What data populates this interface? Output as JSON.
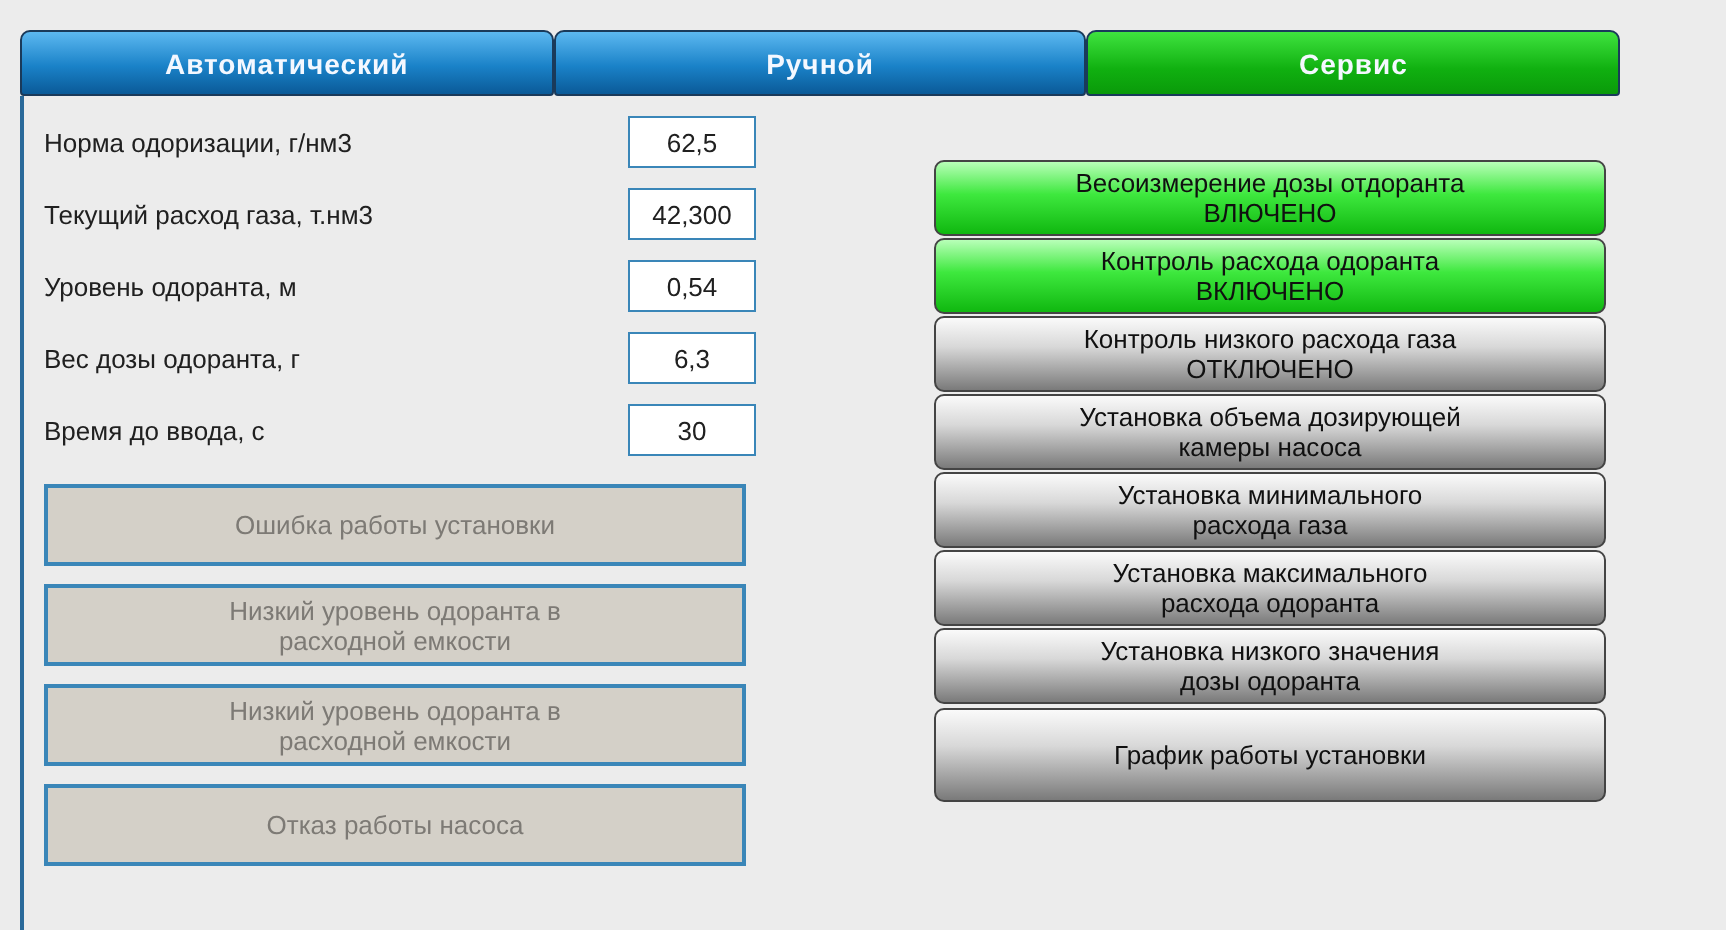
{
  "tabs": [
    {
      "label": "Автоматический",
      "selected": false
    },
    {
      "label": "Ручной",
      "selected": false
    },
    {
      "label": "Сервис",
      "selected": true
    }
  ],
  "parameters": [
    {
      "label": "Норма одоризации, г/нм3",
      "value": "62,5"
    },
    {
      "label": "Текущий расход газа, т.нм3",
      "value": "42,300"
    },
    {
      "label": "Уровень одоранта, м",
      "value": "0,54"
    },
    {
      "label": "Вес дозы одоранта, г",
      "value": "6,3"
    },
    {
      "label": "Время до ввода, с",
      "value": "30"
    }
  ],
  "alarms": [
    {
      "lines": [
        "Ошибка работы установки"
      ],
      "active": false
    },
    {
      "lines": [
        "Низкий уровень одоранта в",
        "расходной емкости"
      ],
      "active": false
    },
    {
      "lines": [
        "Низкий уровень одоранта в",
        "расходной емкости"
      ],
      "active": false
    },
    {
      "lines": [
        "Отказ работы насоса"
      ],
      "active": false
    }
  ],
  "service_buttons": [
    {
      "lines": [
        "Весоизмерение дозы отдоранта",
        "ВЛЮЧЕНО"
      ],
      "on": true
    },
    {
      "lines": [
        "Контроль расхода одоранта",
        "ВКЛЮЧЕНО"
      ],
      "on": true
    },
    {
      "lines": [
        "Контроль низкого расхода газа",
        "ОТКЛЮЧЕНО"
      ],
      "on": false
    },
    {
      "lines": [
        "Установка объема дозирующей",
        "камеры насоса"
      ],
      "on": false
    },
    {
      "lines": [
        "Установка минимального",
        "расхода газа"
      ],
      "on": false
    },
    {
      "lines": [
        "Установка максимального",
        "расхода одоранта"
      ],
      "on": false
    },
    {
      "lines": [
        "Установка низкого значения",
        "дозы одоранта"
      ],
      "on": false
    },
    {
      "lines": [
        "График работы установки"
      ],
      "on": false
    }
  ]
}
